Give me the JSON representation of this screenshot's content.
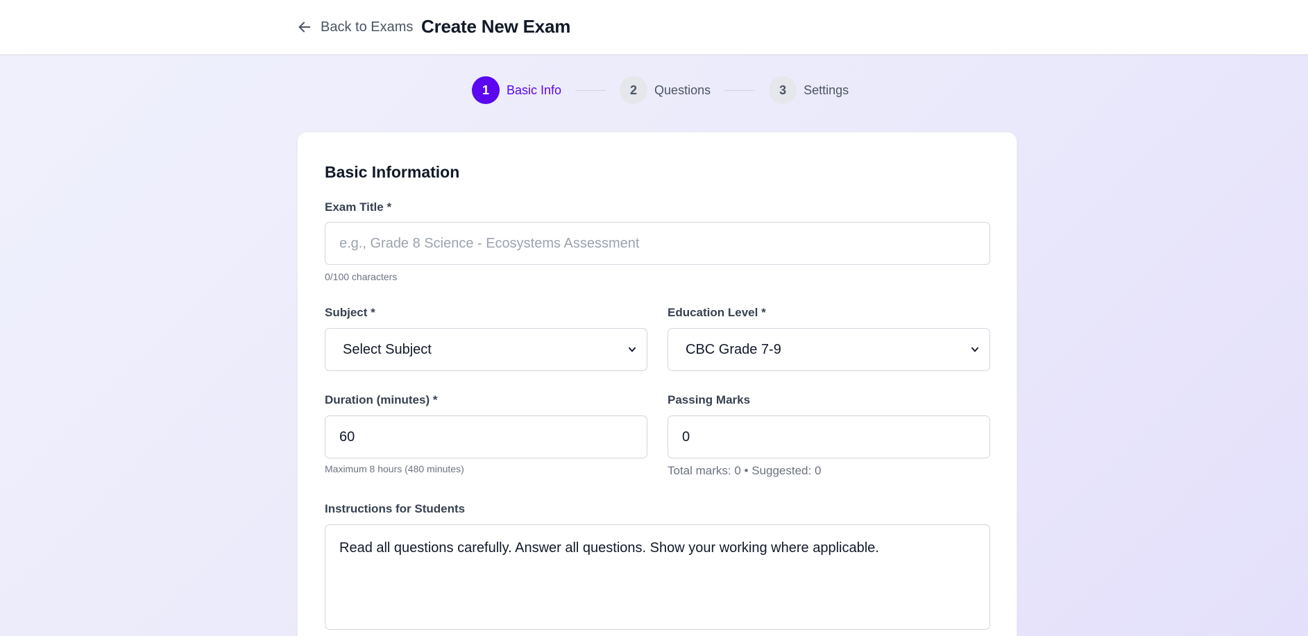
{
  "header": {
    "back_label": "Back to Exams",
    "title": "Create New Exam"
  },
  "stepper": {
    "steps": [
      {
        "number": "1",
        "label": "Basic Info",
        "active": true
      },
      {
        "number": "2",
        "label": "Questions",
        "active": false
      },
      {
        "number": "3",
        "label": "Settings",
        "active": false
      }
    ]
  },
  "form": {
    "section_title": "Basic Information",
    "exam_title": {
      "label": "Exam Title *",
      "value": "",
      "placeholder": "e.g., Grade 8 Science - Ecosystems Assessment",
      "hint": "0/100 characters"
    },
    "subject": {
      "label": "Subject *",
      "value": "Select Subject"
    },
    "education_level": {
      "label": "Education Level *",
      "value": "CBC Grade 7-9"
    },
    "duration": {
      "label": "Duration (minutes) *",
      "value": "60",
      "hint": "Maximum 8 hours (480 minutes)"
    },
    "passing_marks": {
      "label": "Passing Marks",
      "value": "0",
      "hint": "Total marks: 0 • Suggested: 0"
    },
    "instructions": {
      "label": "Instructions for Students",
      "value": "Read all questions carefully. Answer all questions. Show your working where applicable."
    }
  },
  "colors": {
    "accent": "#5b08f0",
    "background": "#ebeafb"
  },
  "icons": {
    "back": "arrow-left-icon",
    "select": "chevron-down-icon"
  }
}
